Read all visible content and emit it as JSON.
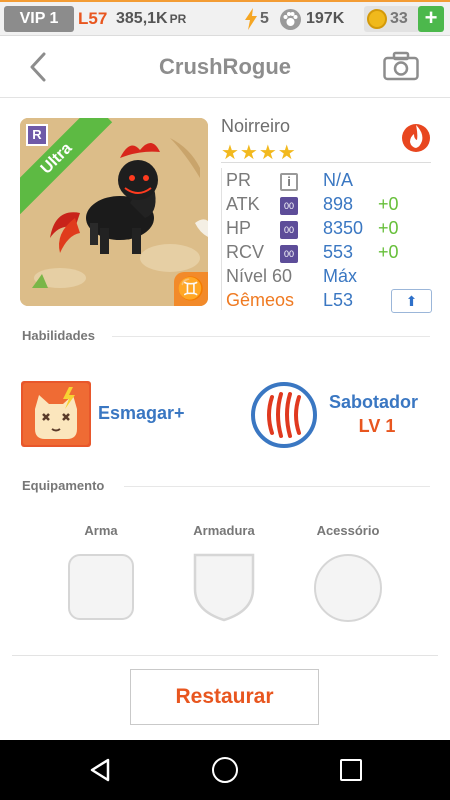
{
  "status_bar": {
    "vip": "VIP 1",
    "level": "L57",
    "pr_value": "385,1K",
    "pr_suffix": "PR",
    "energy": "5",
    "paws": "197K",
    "coins": "33",
    "plus": "+"
  },
  "header": {
    "title": "CrushRogue",
    "back_icon": "chevron-left-icon",
    "camera_icon": "camera-icon"
  },
  "pet": {
    "name": "Noirreiro",
    "rarity": "Ultra",
    "badge": "R",
    "stars": "★★★★",
    "element_icon": "fire-icon",
    "sign_glyph": "♊",
    "stats": {
      "pr_label": "PR",
      "pr_icon": "i",
      "pr_value": "N/A",
      "atk_label": "ATK",
      "atk_value": "898",
      "atk_bonus": "+0",
      "hp_label": "HP",
      "hp_value": "8350",
      "hp_bonus": "+0",
      "rcv_label": "RCV",
      "rcv_value": "553",
      "rcv_bonus": "+0",
      "stat_icon_text": "00",
      "level_label": "Nível 60",
      "level_value": "Máx",
      "gem_label": "Gêmeos",
      "gem_value": "L53",
      "upgrade_glyph": "⬆"
    }
  },
  "skills": {
    "section_label": "Habilidades",
    "skill_1": "Esmagar+",
    "skill_2": "Sabotador",
    "skill_2_level": "LV 1"
  },
  "equipment": {
    "section_label": "Equipamento",
    "weapon": "Arma",
    "armor": "Armadura",
    "accessory": "Acessório"
  },
  "actions": {
    "restore": "Restaurar"
  },
  "colors": {
    "accent_orange": "#e8561f",
    "value_blue": "#3a77c2",
    "bonus_green": "#66bf39",
    "rarity_green": "#5dba43"
  }
}
